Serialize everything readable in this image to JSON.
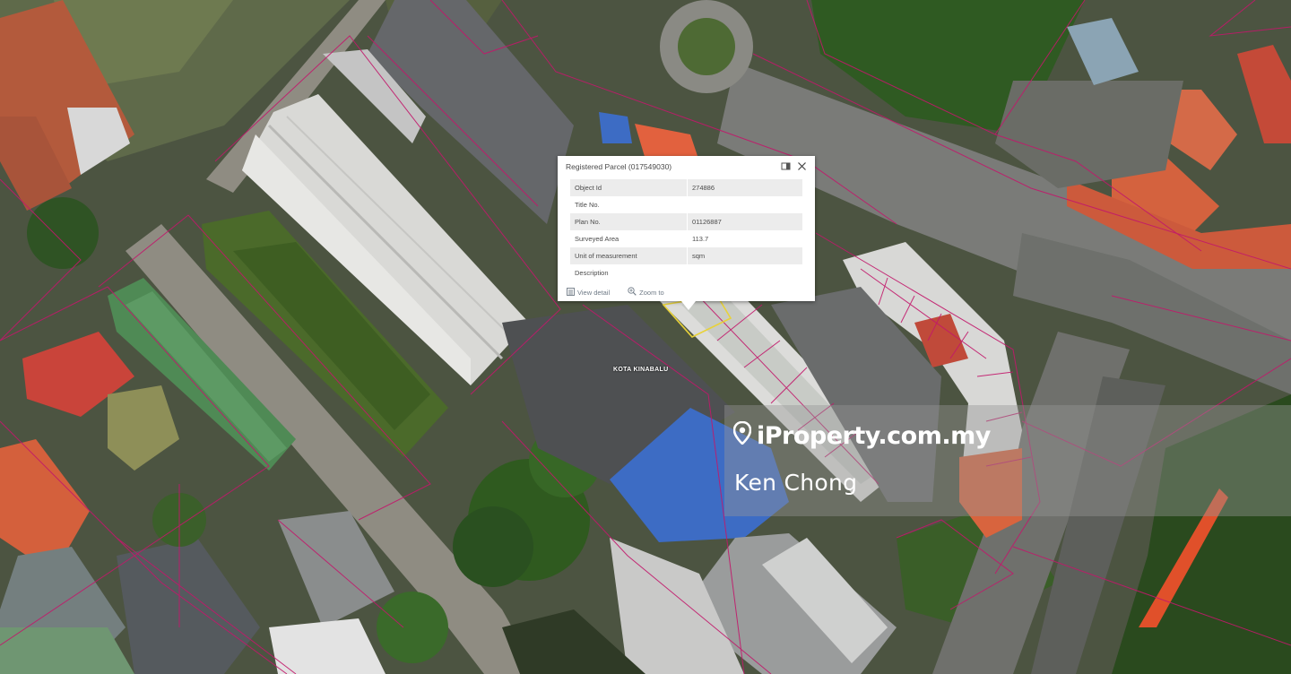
{
  "map": {
    "road_label": "KOTA KINABALU"
  },
  "popup": {
    "title": "Registered Parcel (017549030)",
    "rows": [
      {
        "label": "Object Id",
        "value": "274886"
      },
      {
        "label": "Title No.",
        "value": ""
      },
      {
        "label": "Plan No.",
        "value": "01126887"
      },
      {
        "label": "Surveyed Area",
        "value": "113.7"
      },
      {
        "label": "Unit of measurement",
        "value": "sqm"
      },
      {
        "label": "Description",
        "value": ""
      }
    ],
    "actions": {
      "view_detail": "View detail",
      "zoom_to": "Zoom to"
    },
    "icons": {
      "dock": "dock-icon",
      "close": "close-icon",
      "view_detail": "view-detail-icon",
      "zoom_to": "zoom-to-icon"
    }
  },
  "watermark": {
    "brand": "iProperty.com.my",
    "agent": "Ken Chong"
  },
  "colors": {
    "parcel_boundary": "#c2186b",
    "selected_parcel": "#e8d23a",
    "vegetation": "#3f6a2c",
    "roof_orange": "#d85d3a",
    "roof_blue": "#3a6bc4",
    "road": "#8c8c84"
  }
}
